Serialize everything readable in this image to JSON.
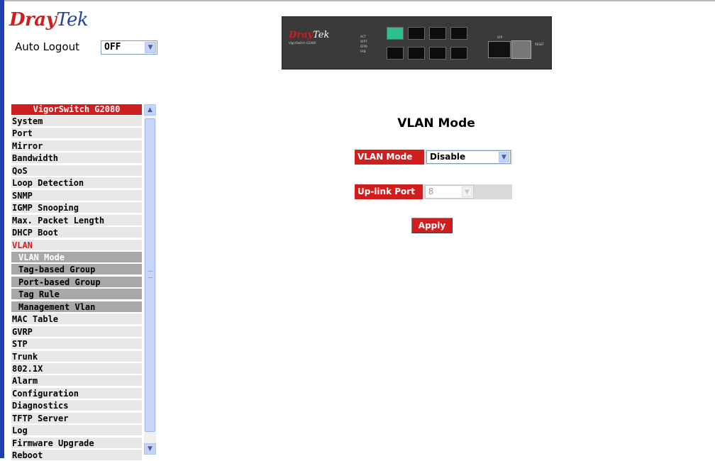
{
  "logo": {
    "part1": "Dray",
    "part2": "Tek"
  },
  "auto_logout": {
    "label": "Auto Logout",
    "value": "OFF"
  },
  "device": {
    "brand_part1": "Dray",
    "brand_part2": "Tek",
    "model": "VigorSwitch G2080",
    "leds": [
      "ACT",
      "SFP7",
      "SFP8",
      "FAN"
    ],
    "sfp_label": "SFP",
    "reset_label": "RESET"
  },
  "menu": {
    "header": "VigorSwitch G2080",
    "items": [
      {
        "label": "System"
      },
      {
        "label": "Port"
      },
      {
        "label": "Mirror"
      },
      {
        "label": "Bandwidth"
      },
      {
        "label": "QoS"
      },
      {
        "label": "Loop Detection"
      },
      {
        "label": "SNMP"
      },
      {
        "label": "IGMP Snooping"
      },
      {
        "label": "Max. Packet Length"
      },
      {
        "label": "DHCP Boot"
      },
      {
        "label": "VLAN"
      },
      {
        "label": "VLAN Mode"
      },
      {
        "label": "Tag-based Group"
      },
      {
        "label": "Port-based Group"
      },
      {
        "label": "Tag Rule"
      },
      {
        "label": "Management Vlan"
      },
      {
        "label": "MAC Table"
      },
      {
        "label": "GVRP"
      },
      {
        "label": "STP"
      },
      {
        "label": "Trunk"
      },
      {
        "label": "802.1X"
      },
      {
        "label": "Alarm"
      },
      {
        "label": "Configuration"
      },
      {
        "label": "Diagnostics"
      },
      {
        "label": "TFTP Server"
      },
      {
        "label": "Log"
      },
      {
        "label": "Firmware Upgrade"
      },
      {
        "label": "Reboot"
      }
    ]
  },
  "main": {
    "title": "VLAN Mode",
    "vlan_mode": {
      "label": "VLAN Mode",
      "value": "Disable"
    },
    "uplink_port": {
      "label": "Up-link Port",
      "value": "8"
    },
    "apply_label": "Apply"
  },
  "colors": {
    "accent": "#d01d1d",
    "brand_blue": "#2343a8",
    "menu_bg": "#e7e7e7",
    "submenu_bg": "#a8a8a8"
  }
}
